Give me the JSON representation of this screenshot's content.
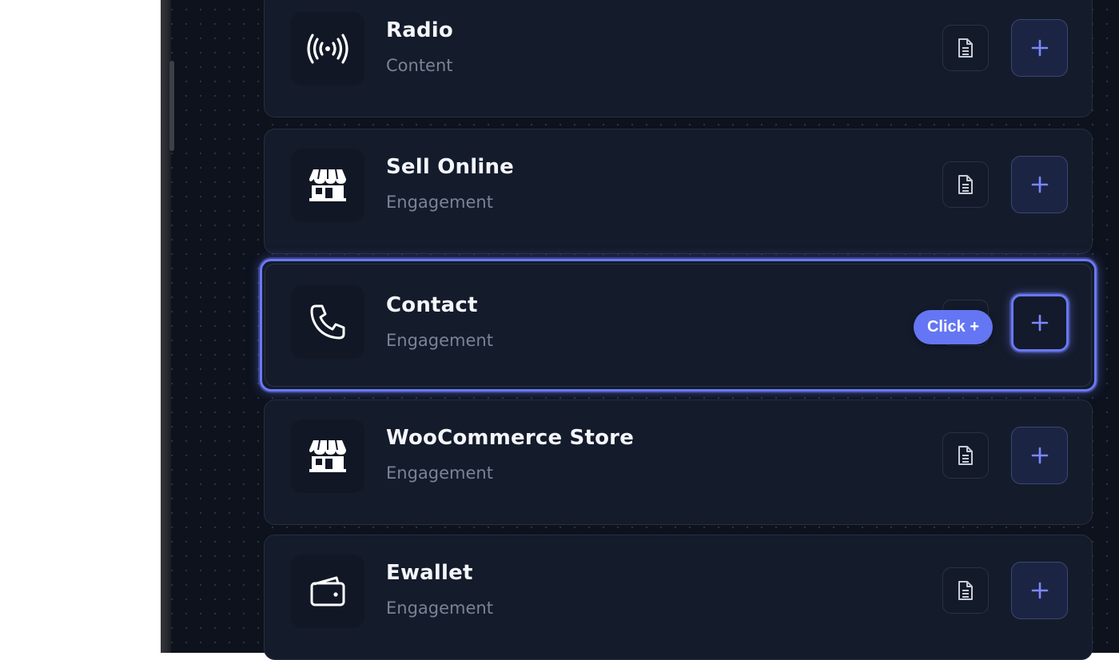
{
  "items": [
    {
      "title": "Radio",
      "category": "Content",
      "icon": "radio-broadcast-icon"
    },
    {
      "title": "Sell Online",
      "category": "Engagement",
      "icon": "storefront-icon"
    },
    {
      "title": "Contact",
      "category": "Engagement",
      "icon": "phone-icon"
    },
    {
      "title": "WooCommerce Store",
      "category": "Engagement",
      "icon": "storefront-icon"
    },
    {
      "title": "Ewallet",
      "category": "Engagement",
      "icon": "wallet-icon"
    }
  ],
  "tooltip": {
    "label": "Click +"
  },
  "colors": {
    "panel_bg": "#0d121d",
    "card_bg": "#141b2b",
    "accent": "#6a79f5",
    "add_button_bg": "#1c2444",
    "title_text": "#f4f6fb",
    "subtitle_text": "#7a8396"
  }
}
